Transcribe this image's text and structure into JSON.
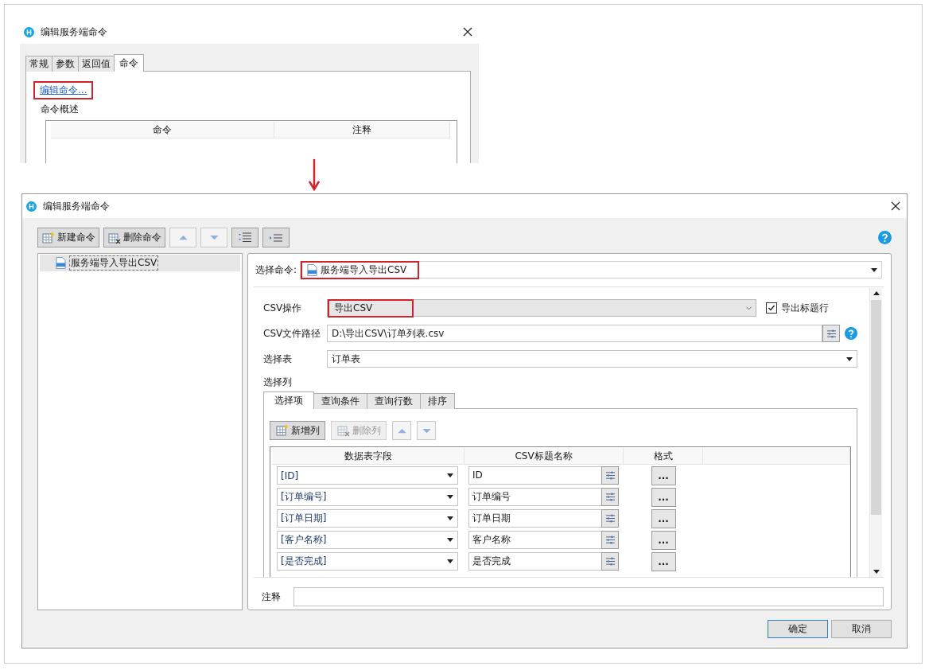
{
  "top_dialog": {
    "title": "编辑服务端命令",
    "tabs": [
      {
        "label": "常规",
        "selected": false
      },
      {
        "label": "参数",
        "selected": false
      },
      {
        "label": "返回值",
        "selected": false
      },
      {
        "label": "命令",
        "selected": true
      }
    ],
    "link": {
      "label": "编辑命令...",
      "highlighted": true
    },
    "summary_label": "命令概述",
    "columns": [
      "命令",
      "注释"
    ]
  },
  "dialog": {
    "title": "编辑服务端命令",
    "toolbar": [
      {
        "kind": "new",
        "label": "新建命令"
      },
      {
        "kind": "delete",
        "label": "删除命令"
      },
      {
        "kind": "up"
      },
      {
        "kind": "down"
      },
      {
        "kind": "expand"
      },
      {
        "kind": "collapse"
      }
    ],
    "tree": [
      {
        "label": "服务端导入导出CSV",
        "selected": true
      }
    ],
    "select_command": {
      "label": "选择命令:",
      "value": "服务端导入导出CSV",
      "highlighted": true
    },
    "csv_operation": {
      "label": "CSV操作",
      "value": "导出CSV",
      "highlighted": true
    },
    "export_header": {
      "label": "导出标题行",
      "checked": true
    },
    "file_path": {
      "label": "CSV文件路径",
      "value": "D:\\导出CSV\\订单列表.csv"
    },
    "select_table": {
      "label": "选择表",
      "value": "订单表"
    },
    "columns_label": "选择列",
    "tabs": [
      {
        "label": "选择项",
        "selected": true
      },
      {
        "label": "查询条件",
        "selected": false
      },
      {
        "label": "查询行数",
        "selected": false
      },
      {
        "label": "排序",
        "selected": false
      }
    ],
    "grid_toolbar": [
      {
        "kind": "new",
        "label": "新增列",
        "disabled": false
      },
      {
        "kind": "delete",
        "label": "删除列",
        "disabled": true
      },
      {
        "kind": "up"
      },
      {
        "kind": "down"
      }
    ],
    "grid": {
      "columns": [
        "数据表字段",
        "CSV标题名称",
        "格式"
      ],
      "rows": [
        {
          "field": "[ID]",
          "header": "ID",
          "format": "..."
        },
        {
          "field": "[订单编号]",
          "header": "订单编号",
          "format": "..."
        },
        {
          "field": "[订单日期]",
          "header": "订单日期",
          "format": "..."
        },
        {
          "field": "[客户名称]",
          "header": "客户名称",
          "format": "..."
        },
        {
          "field": "[是否完成]",
          "header": "是否完成",
          "format": "..."
        }
      ]
    },
    "note_label": "注释",
    "buttons": [
      {
        "label": "确定",
        "default": true
      },
      {
        "label": "取消",
        "default": false
      }
    ]
  }
}
